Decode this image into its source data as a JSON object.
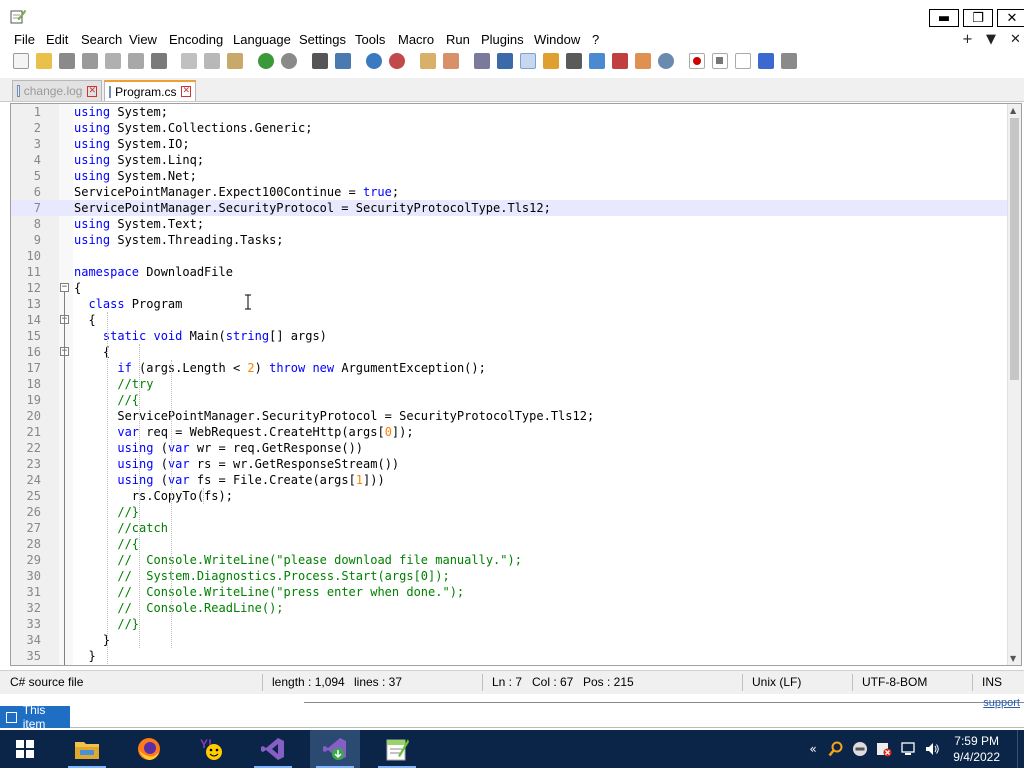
{
  "window": {
    "minimize": "▬",
    "maximize": "❐",
    "close": "✕"
  },
  "menu": {
    "items": [
      "File",
      "Edit",
      "Search",
      "View",
      "Encoding",
      "Language",
      "Settings",
      "Tools",
      "Macro",
      "Run",
      "Plugins",
      "Window",
      "?"
    ],
    "right": [
      "+",
      "▼",
      "✕"
    ]
  },
  "tabs": [
    {
      "label": "change.log",
      "active": false
    },
    {
      "label": "Program.cs",
      "active": true
    }
  ],
  "editor": {
    "current_line": 7,
    "lines": [
      [
        [
          "kw",
          "using"
        ],
        [
          "",
          "  System;"
        ]
      ],
      [
        [
          "kw",
          "using"
        ],
        [
          "",
          "  System.Collections.Generic;"
        ]
      ],
      [
        [
          "kw",
          "using"
        ],
        [
          "",
          "  System.IO;"
        ]
      ],
      [
        [
          "kw",
          "using"
        ],
        [
          "",
          "  System.Linq;"
        ]
      ],
      [
        [
          "kw",
          "using"
        ],
        [
          "",
          "  System.Net;"
        ]
      ],
      [
        [
          "",
          "ServicePointManager.Expect100Continue = "
        ],
        [
          "kw",
          "true"
        ],
        [
          "",
          ";"
        ]
      ],
      [
        [
          "",
          "ServicePointManager.SecurityProtocol = SecurityProtocolType.Tls12;"
        ]
      ],
      [
        [
          "kw",
          "using"
        ],
        [
          "",
          "  System.Text;"
        ]
      ],
      [
        [
          "kw",
          "using"
        ],
        [
          "",
          "  System.Threading.Tasks;"
        ]
      ],
      [],
      [
        [
          "kw",
          "namespace"
        ],
        [
          "",
          "  DownloadFile"
        ]
      ],
      [
        [
          "",
          "{"
        ]
      ],
      [
        [
          "",
          "    "
        ],
        [
          "kw",
          "class"
        ],
        [
          "",
          "  Program"
        ]
      ],
      [
        [
          "",
          "    {"
        ]
      ],
      [
        [
          "",
          "        "
        ],
        [
          "kw",
          "static void"
        ],
        [
          "",
          "  Main("
        ],
        [
          "kw",
          "string"
        ],
        [
          "",
          "[] args)"
        ]
      ],
      [
        [
          "",
          "        {"
        ]
      ],
      [
        [
          "",
          "            "
        ],
        [
          "kw",
          "if"
        ],
        [
          "",
          "  (args.Length < "
        ],
        [
          "nm",
          "2"
        ],
        [
          "",
          ")  "
        ],
        [
          "kw",
          "throw new"
        ],
        [
          "",
          "  ArgumentException();"
        ]
      ],
      [
        [
          "",
          "            "
        ],
        [
          "cm",
          "//try"
        ]
      ],
      [
        [
          "",
          "            "
        ],
        [
          "cm",
          "//{"
        ]
      ],
      [
        [
          "",
          "            ServicePointManager.SecurityProtocol = SecurityProtocolType.Tls12;"
        ]
      ],
      [
        [
          "",
          "            "
        ],
        [
          "kw",
          "var"
        ],
        [
          "",
          "  req = WebRequest.CreateHttp(args["
        ],
        [
          "nm",
          "0"
        ],
        [
          "",
          "]);"
        ]
      ],
      [
        [
          "",
          "            "
        ],
        [
          "kw",
          "using"
        ],
        [
          "",
          "  ("
        ],
        [
          "kw",
          "var"
        ],
        [
          "",
          "  wr = req.GetResponse())"
        ]
      ],
      [
        [
          "",
          "            "
        ],
        [
          "kw",
          "using"
        ],
        [
          "",
          "  ("
        ],
        [
          "kw",
          "var"
        ],
        [
          "",
          "  rs = wr.GetResponseStream())"
        ]
      ],
      [
        [
          "",
          "            "
        ],
        [
          "kw",
          "using"
        ],
        [
          "",
          "  ("
        ],
        [
          "kw",
          "var"
        ],
        [
          "",
          "  fs = File.Create(args["
        ],
        [
          "nm",
          "1"
        ],
        [
          "",
          "]))"
        ]
      ],
      [
        [
          "",
          "                rs.CopyTo(fs);"
        ]
      ],
      [
        [
          "",
          "            "
        ],
        [
          "cm",
          "//}"
        ]
      ],
      [
        [
          "",
          "            "
        ],
        [
          "cm",
          "//catch"
        ]
      ],
      [
        [
          "",
          "            "
        ],
        [
          "cm",
          "//{"
        ]
      ],
      [
        [
          "",
          "            "
        ],
        [
          "cm",
          "//    Console.WriteLine(\"please download file manually.\");"
        ]
      ],
      [
        [
          "",
          "            "
        ],
        [
          "cm",
          "//    System.Diagnostics.Process.Start(args[0]);"
        ]
      ],
      [
        [
          "",
          "            "
        ],
        [
          "cm",
          "//    Console.WriteLine(\"press enter when done.\");"
        ]
      ],
      [
        [
          "",
          "            "
        ],
        [
          "cm",
          "//    Console.ReadLine();"
        ]
      ],
      [
        [
          "",
          "            "
        ],
        [
          "cm",
          "//}"
        ]
      ],
      [
        [
          "",
          "        }"
        ]
      ],
      [
        [
          "",
          "    }"
        ]
      ]
    ]
  },
  "status": {
    "file_type": "C# source file",
    "length": "length : 1,094",
    "lines": "lines : 37",
    "ln": "Ln : 7",
    "col": "Col : 67",
    "pos": "Pos : 215",
    "eol": "Unix (LF)",
    "encoding": "UTF-8-BOM",
    "mode": "INS"
  },
  "notification": "This item",
  "support_link": "support",
  "taskbar": {
    "time": "7:59 PM",
    "date": "9/4/2022"
  },
  "colors": {
    "keyword": "#0000ff",
    "comment": "#008000",
    "number": "#ff8000",
    "taskbar": "#0a2547",
    "current_line": "#e8e8ff"
  }
}
